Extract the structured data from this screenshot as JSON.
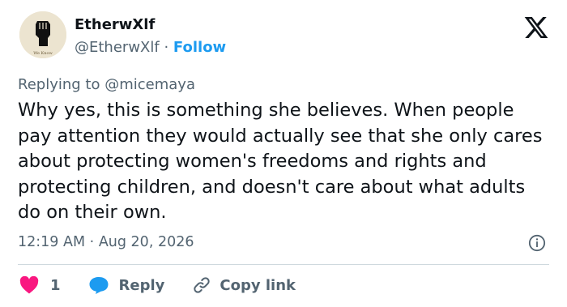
{
  "author": {
    "name": "EtherwXlf",
    "handle": "@EtherwXlf",
    "separator": "·",
    "follow_label": "Follow",
    "avatar_caption": "We Know"
  },
  "reply_context": {
    "prefix": "Replying to",
    "mention": "@micemaya"
  },
  "tweet": {
    "text": "Why yes, this is something she believes. When people pay attention they would actually see that she only cares about protecting women's freedoms and rights and protecting children, and doesn't care about what adults do on their own.",
    "time": "12:19 AM",
    "separator": "·",
    "date": "Aug 20, 2026"
  },
  "actions": {
    "like_count": "1",
    "reply_label": "Reply",
    "copy_label": "Copy link"
  },
  "icons": {
    "brand": "x-logo-icon",
    "info": "info-icon",
    "like": "heart-icon",
    "reply": "speech-bubble-icon",
    "copy": "link-icon"
  },
  "colors": {
    "text": "#0f1419",
    "secondary": "#536471",
    "accent": "#1d9bf0",
    "like": "#f91880",
    "divider": "#cfd9de"
  }
}
